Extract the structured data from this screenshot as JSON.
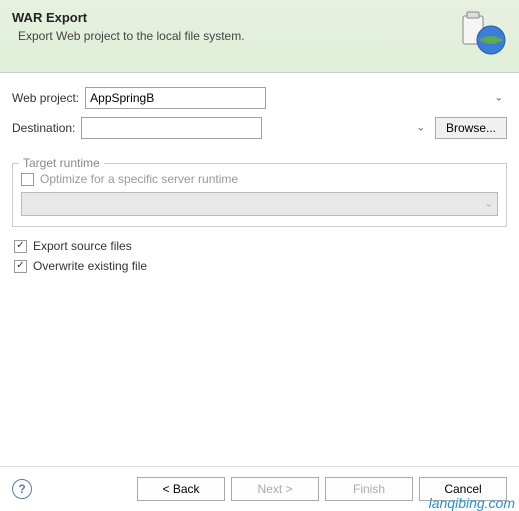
{
  "header": {
    "title": "WAR Export",
    "subtitle": "Export Web project to the local file system."
  },
  "form": {
    "webProjectLabel": "Web project:",
    "webProjectValue": "AppSpringB",
    "destinationLabel": "Destination:",
    "destinationValue": "",
    "browseLabel": "Browse..."
  },
  "runtime": {
    "legend": "Target runtime",
    "optimizeLabel": "Optimize for a specific server runtime",
    "optimizeChecked": false
  },
  "options": {
    "exportSourceLabel": "Export source files",
    "exportSourceChecked": true,
    "overwriteLabel": "Overwrite existing file",
    "overwriteChecked": true
  },
  "buttons": {
    "back": "< Back",
    "next": "Next >",
    "finish": "Finish",
    "cancel": "Cancel"
  },
  "watermark": "lanqibing.com"
}
